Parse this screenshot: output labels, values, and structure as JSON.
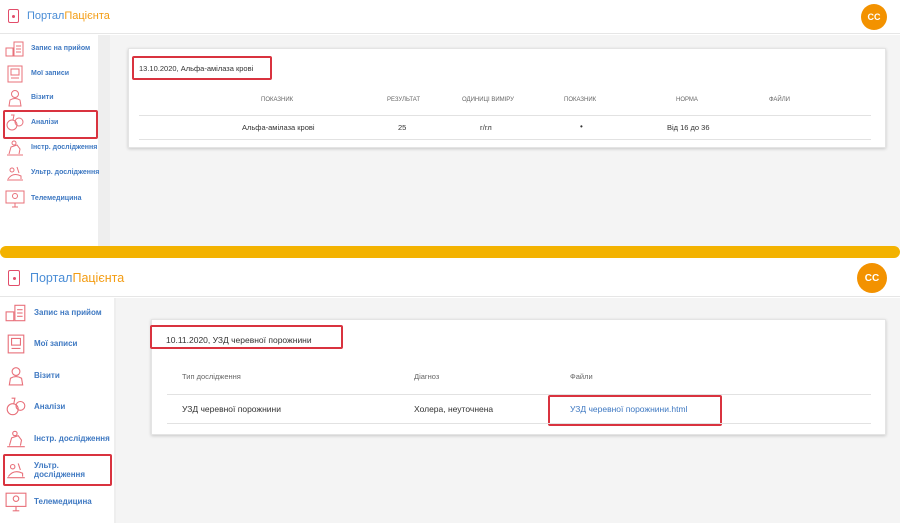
{
  "app": {
    "logo_part1": "Портал",
    "logo_part2": "Пацієнта",
    "user_initials": "CC"
  },
  "sidebar": {
    "items": [
      {
        "label": "Запис на прийом",
        "icon": "appointment-icon"
      },
      {
        "label": "Мої записи",
        "icon": "records-icon"
      },
      {
        "label": "Візити",
        "icon": "doctor-visit-icon"
      },
      {
        "label": "Аналізи",
        "icon": "analyses-icon"
      },
      {
        "label": "Інстр. дослідження",
        "icon": "instrumental-research-icon"
      },
      {
        "label": "Ультр. дослідження",
        "icon": "ultrasound-icon"
      },
      {
        "label": "Телемедицина",
        "icon": "telemedicine-icon"
      }
    ],
    "p2_ultra_line1": "Ультр.",
    "p2_ultra_line2": "дослідження"
  },
  "analysis": {
    "card_title": "13.10.2020, Альфа-аміла­за крові",
    "headers": [
      "ПОКАЗНИК",
      "РЕЗУЛЬТАТ",
      "ОДИНИЦІ ВИМІРУ",
      "ПОКАЗНИК",
      "НОРМА",
      "ФАЙЛИ"
    ],
    "row": {
      "name": "Альфа-аміла­за крові",
      "result": "25",
      "unit": "г/гл",
      "indicator": "•",
      "norm": "Від 16 до 36",
      "files": ""
    }
  },
  "ultrasound": {
    "card_title": "10.11.2020, УЗД черевної порожнини",
    "headers": [
      "Тип дослідження",
      "Діагноз",
      "Файли"
    ],
    "row": {
      "type": "УЗД черевної порожнини",
      "diagnosis": "Холера, неуточнена",
      "file": "УЗД черевної порожнини.html"
    }
  },
  "colors": {
    "accent_orange": "#f39200",
    "link_blue": "#3f79c2",
    "highlight_red": "#d9333f",
    "divider": "#f3b200"
  }
}
